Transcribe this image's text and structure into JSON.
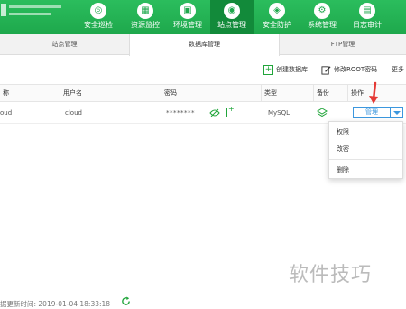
{
  "nav": {
    "items": [
      {
        "label": "安全巡检",
        "glyph": "◎"
      },
      {
        "label": "资源监控",
        "glyph": "▦"
      },
      {
        "label": "环境管理",
        "glyph": "▣"
      },
      {
        "label": "站点管理",
        "glyph": "◉"
      },
      {
        "label": "安全防护",
        "glyph": "◈"
      },
      {
        "label": "系统管理",
        "glyph": "⚙"
      },
      {
        "label": "日志审计",
        "glyph": "▤"
      }
    ],
    "active": "站点管理"
  },
  "tabs": [
    {
      "label": "站点管理"
    },
    {
      "label": "数据库管理"
    },
    {
      "label": "FTP管理"
    }
  ],
  "toolbar": {
    "create_db": "创建数据库",
    "change_root_pwd": "修改ROOT密码",
    "more": "更多"
  },
  "table": {
    "headers": {
      "name": "称",
      "username": "用户名",
      "password": "密码",
      "type": "类型",
      "backup": "备份",
      "action": "操作"
    },
    "rows": [
      {
        "name": "oud",
        "username": "cloud",
        "password": "********",
        "type": "MySQL",
        "action": "管理"
      }
    ]
  },
  "dropdown": {
    "items": [
      "权限",
      "改密",
      "删除"
    ]
  },
  "footer": {
    "text": "据更新时间: 2019-01-04 18:33:18"
  },
  "watermark": "软件技巧",
  "colors": {
    "brand_green": "#1ea84c",
    "accent_blue": "#3c97de",
    "arrow_red": "#e53935"
  }
}
